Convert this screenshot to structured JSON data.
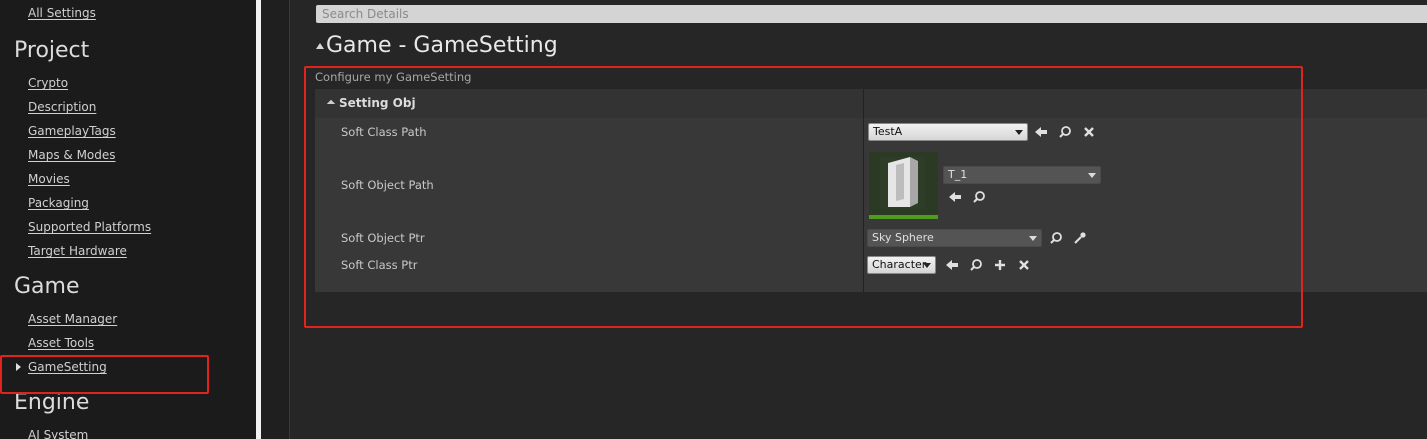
{
  "sidebar": {
    "all_settings": "All Settings",
    "sections": [
      {
        "title": "Project",
        "items": [
          "Crypto",
          "Description",
          "GameplayTags",
          "Maps & Modes",
          "Movies",
          "Packaging",
          "Supported Platforms",
          "Target Hardware"
        ]
      },
      {
        "title": "Game",
        "items": [
          "Asset Manager",
          "Asset Tools",
          "GameSetting"
        ]
      },
      {
        "title": "Engine",
        "items": [
          "AI System"
        ]
      }
    ],
    "selected_item": "GameSetting"
  },
  "search": {
    "placeholder": "Search Details"
  },
  "details": {
    "title": "Game - GameSetting",
    "subtitle": "Configure my GameSetting",
    "category": "Setting Obj",
    "rows": [
      {
        "label": "Soft Class Path",
        "value": "TestA"
      },
      {
        "label": "Soft Object Path",
        "value": "T_1"
      },
      {
        "label": "Soft Object Ptr",
        "value": "Sky Sphere"
      },
      {
        "label": "Soft Class Ptr",
        "value": "Character"
      }
    ]
  },
  "colors": {
    "highlight": "#e0231c",
    "thumbnail_accent": "#4f9a1f",
    "background": "#262626",
    "sidebar": "#1b1b1b"
  },
  "icons": [
    "use-selected-arrow-icon",
    "browse-search-icon",
    "clear-x-icon",
    "eyedropper-icon",
    "add-plus-icon"
  ]
}
